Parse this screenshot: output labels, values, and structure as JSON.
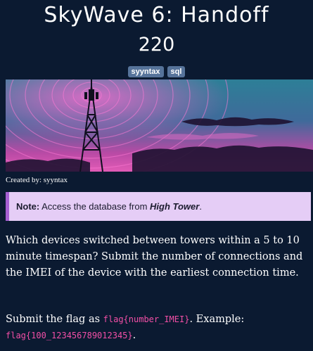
{
  "challenge": {
    "title": "SkyWave 6: Handoff",
    "points": "220",
    "tags": [
      "syyntax",
      "sql"
    ],
    "credit": "Created by: syyntax"
  },
  "note": {
    "label": "Note:",
    "text_before": " Access the database from ",
    "emphasis": "High Tower",
    "text_after": "."
  },
  "question": {
    "text": "Which devices switched between towers within a 5 to 10 minute timespan? Submit the number of connections and the IMEI of the device with the earliest connection time."
  },
  "submit": {
    "text_before": "Submit the flag as ",
    "format": "flag{number_IMEI}",
    "text_middle": ". Example: ",
    "example": "flag{100_123456789012345}",
    "text_after": "."
  },
  "colors": {
    "background": "#0b1a31",
    "tag_background": "#56739a",
    "note_background": "#e5cdf6",
    "note_border": "#a65fd2",
    "code": "#f24fa6"
  },
  "icons": {
    "banner": "radio-tower-illustration"
  }
}
